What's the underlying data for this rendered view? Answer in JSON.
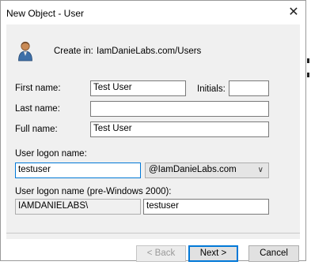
{
  "window": {
    "title": "New Object - User",
    "close_glyph": "✕"
  },
  "create_in": {
    "label": "Create in:",
    "path": "IamDanieLabs.com/Users"
  },
  "fields": {
    "first_name": {
      "label": "First name:",
      "value": "Test User"
    },
    "initials": {
      "label": "Initials:",
      "value": ""
    },
    "last_name": {
      "label": "Last name:",
      "value": ""
    },
    "full_name": {
      "label": "Full name:",
      "value": "Test User"
    },
    "logon_name": {
      "label": "User logon name:",
      "value": "testuser"
    },
    "domain_suffix": {
      "value": "@IamDanieLabs.com"
    },
    "pre2000": {
      "label": "User logon name (pre-Windows 2000):",
      "domain": "IAMDANIELABS\\",
      "value": "testuser"
    }
  },
  "buttons": {
    "back": "< Back",
    "next": "Next >",
    "cancel": "Cancel"
  },
  "icons": {
    "user": "user-icon",
    "close": "close-icon",
    "dropdown": "chevron-down-icon"
  },
  "colors": {
    "focus_border": "#0078d7",
    "dialog_bg": "#f0f0f0"
  }
}
